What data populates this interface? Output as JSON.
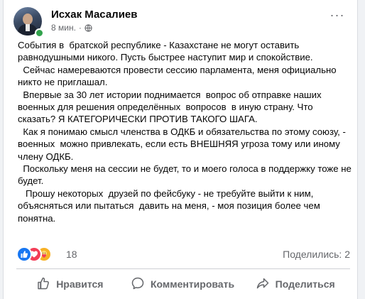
{
  "post": {
    "author": "Исхак Масалиев",
    "time": "8 мин.",
    "meta_separator": "·",
    "visibility_icon": "globe-icon",
    "more_label": "···",
    "paragraphs": [
      "События в  братской республике - Казахстане не могут оставить равнодушными никого. Пусть быстрее наступит мир и спокойствие.",
      "  Сейчас намереваются провести сессию парламента, меня официально никто не приглашал.",
      "  Впервые за 30 лет истории поднимается  вопрос об отправке наших военных для решения определённых  вопросов  в иную страну. Что сказать? Я КАТЕГОРИЧЕСКИ ПРОТИВ ТАКОГО ШАГА.",
      "  Как я понимаю смысл членства в ОДКБ и обязательства по этому союзу, - военных  можно привлекать, если есть ВНЕШНЯЯ угроза тому или иному члену ОДКБ.",
      "  Поскольку меня на сессии не будет, то и моего голоса в поддержку тоже не будет.",
      "   Прошу некоторых  друзей по фейсбуку - не требуйте выйти к ним, объясняться или пытаться  давить на меня, - моя позиция более чем понятна."
    ]
  },
  "reactions": {
    "icons": [
      "like-icon",
      "love-icon",
      "care-icon"
    ],
    "count": "18",
    "shares": "Поделились: 2"
  },
  "actions": {
    "like": "Нравится",
    "comment": "Комментировать",
    "share": "Поделиться"
  },
  "colors": {
    "accent": "#1877f2",
    "love": "#f33e58",
    "care": "#f7b125",
    "online": "#31a24c",
    "secondary_text": "#65676b"
  }
}
